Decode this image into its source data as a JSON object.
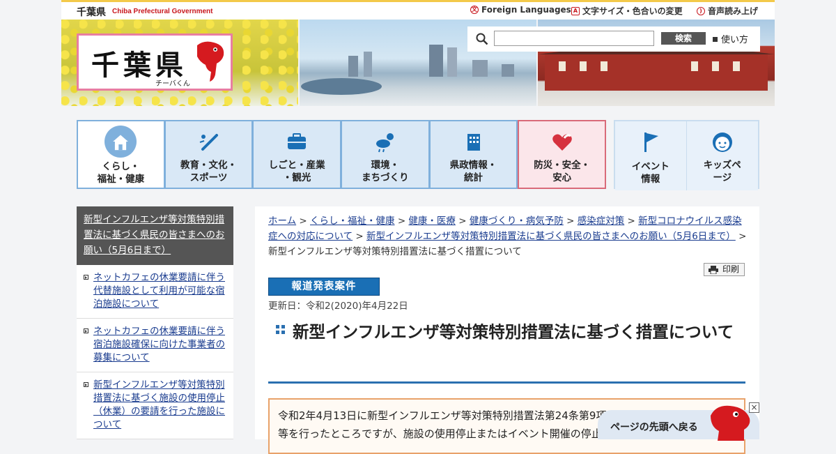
{
  "header": {
    "brand": "千葉県",
    "brand_en": "Chiba Prefectural Government",
    "utilities": [
      "Foreign Languages",
      "文字サイズ・色合いの変更",
      "音声読み上げ"
    ],
    "logo_text": "千葉県",
    "logo_sub": "チーバくん",
    "search": {
      "placeholder": "",
      "button": "検索",
      "help": "使い方"
    }
  },
  "nav": {
    "items": [
      {
        "label": "くらし・\n福祉・健康",
        "icon": "house-icon"
      },
      {
        "label": "教育・文化・\nスポーツ",
        "icon": "sports-icon"
      },
      {
        "label": "しごと・産業\n・観光",
        "icon": "briefcase-icon"
      },
      {
        "label": "環境・\nまちづくり",
        "icon": "weather-icon"
      },
      {
        "label": "県政情報・\n統計",
        "icon": "building-icon"
      },
      {
        "label": "防災・安全・\n安心",
        "icon": "heart-icon"
      }
    ],
    "extra": [
      {
        "label": "イベント\n情報",
        "icon": "flag-icon"
      },
      {
        "label": "キッズペ\nージ",
        "icon": "kids-icon"
      }
    ]
  },
  "sidebar": {
    "heading": "新型インフルエンザ等対策特別措置法に基づく県民の皆さまへのお願い（5月6日まで）",
    "items": [
      "ネットカフェの休業要請に伴う代替施設として利用が可能な宿泊施設について",
      "ネットカフェの休業要請に伴う宿泊施設確保に向けた事業者の募集について",
      "新型インフルエンザ等対策特別措置法に基づく施設の使用停止（休業）の要請を行った施設について"
    ]
  },
  "main": {
    "breadcrumb": [
      "ホーム",
      "くらし・福祉・健康",
      "健康・医療",
      "健康づくり・病気予防",
      "感染症対策",
      "新型コロナウイルス感染症への対応について",
      "新型インフルエンザ等対策特別措置法に基づく県民の皆さまへのお願い（5月6日まで）"
    ],
    "breadcrumb_current": "新型インフルエンザ等対策特別措置法に基づく措置について",
    "breadcrumb_sep": ">",
    "print": "印刷",
    "press_label": "報道発表案件",
    "updated": "更新日：令和2(2020)年4月22日",
    "title": "新型インフルエンザ等対策特別措置法に基づく措置について",
    "notice_line1": "令和2年4月13日に新型インフルエンザ等対策特別措置法第24条第9項に基づき、休業の",
    "notice_line2": "等を行ったところですが、施設の使用停止またはイベント開催の停止の協力を要請し"
  },
  "back_to_top": "ページの先頭へ戻る",
  "close": "×",
  "colors": {
    "accent_blue": "#1a6fb5",
    "brand_red": "#c8161d",
    "nav_border": "#7fb0dc",
    "bousai_border": "#d96a79"
  }
}
